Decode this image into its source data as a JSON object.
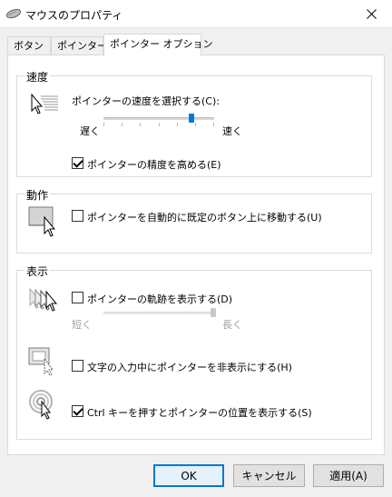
{
  "window": {
    "title": "マウスのプロパティ"
  },
  "tabs": [
    "ボタン",
    "ポインター",
    "ポインター オプション"
  ],
  "motion": {
    "title": "速度",
    "select_label": "ポインターの速度を選択する(C):",
    "slow": "遅く",
    "fast": "速く",
    "speed_level": 0.8,
    "precision_label": "ポインターの精度を高める(E)",
    "precision_checked": true
  },
  "snap": {
    "title": "動作",
    "label": "ポインターを自動的に既定のボタン上に移動する(U)",
    "checked": false
  },
  "visibility": {
    "title": "表示",
    "trails_label": "ポインターの軌跡を表示する(D)",
    "trails_checked": false,
    "short": "短く",
    "long": "長く",
    "trail_level": 1.0,
    "hide_label": "文字の入力中にポインターを非表示にする(H)",
    "hide_checked": false,
    "ctrl_label": "Ctrl キーを押すとポインターの位置を表示する(S)",
    "ctrl_checked": true
  },
  "buttons": {
    "ok": "OK",
    "cancel": "キャンセル",
    "apply": "適用(A)"
  },
  "colors": {
    "accent": "#0078d7"
  }
}
